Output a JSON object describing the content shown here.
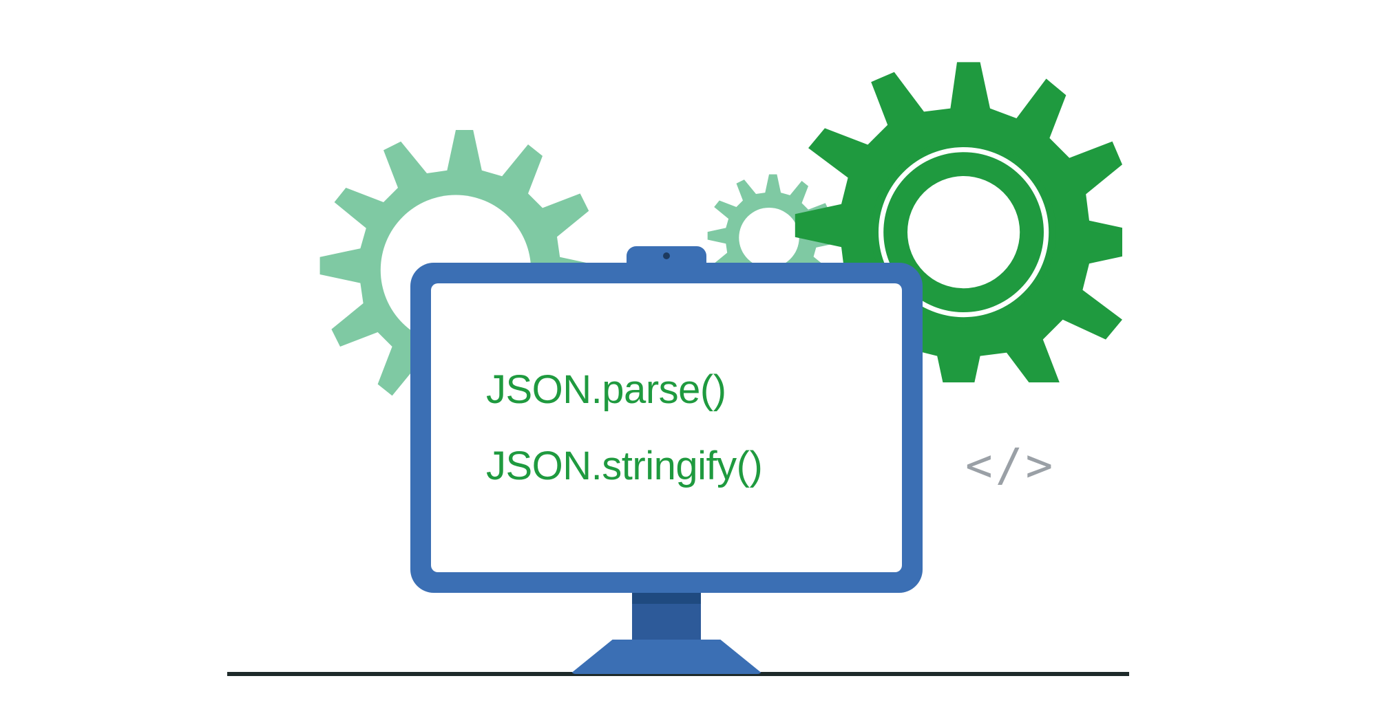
{
  "screen": {
    "line1": "JSON.parse()",
    "line2": "JSON.stringify()"
  },
  "code_symbol": "</>",
  "colors": {
    "gear_light": "#7fc9a3",
    "gear_dark": "#1f9a3f",
    "monitor_bezel": "#3b6fb4",
    "monitor_neck": "#2d5a99",
    "text_green": "#1f9a3f",
    "code_gray": "#9aa0a6",
    "baseline": "#1e2a2a"
  }
}
